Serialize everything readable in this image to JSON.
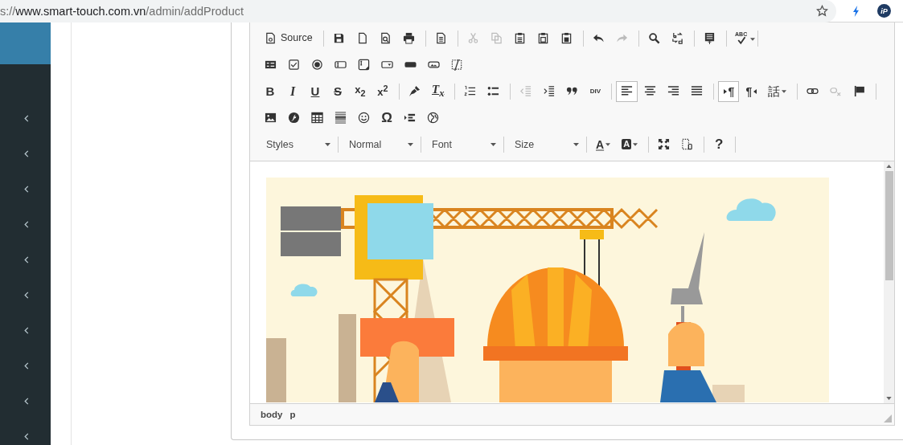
{
  "browser": {
    "url_prefix": "s://",
    "url_host": "www.smart-touch.com.vn",
    "url_path": "/admin/addProduct",
    "extension_badge": "iP"
  },
  "editor": {
    "toolbar": [
      [
        [
          {
            "kind": "source",
            "label": "Source",
            "disabled": false,
            "selected": false
          }
        ],
        [
          {
            "kind": "save",
            "disabled": false,
            "selected": false
          },
          {
            "kind": "newpage",
            "disabled": false,
            "selected": false
          },
          {
            "kind": "preview",
            "disabled": false,
            "selected": false
          },
          {
            "kind": "print",
            "disabled": false,
            "selected": false
          }
        ],
        [
          {
            "kind": "templates",
            "disabled": false,
            "selected": false
          }
        ],
        [
          {
            "kind": "cut",
            "disabled": true,
            "selected": false
          },
          {
            "kind": "copy",
            "disabled": true,
            "selected": false
          },
          {
            "kind": "paste",
            "disabled": false,
            "selected": false
          },
          {
            "kind": "paste-text",
            "disabled": false,
            "selected": false
          },
          {
            "kind": "paste-word",
            "disabled": false,
            "selected": false
          }
        ],
        [
          {
            "kind": "undo",
            "disabled": false,
            "selected": false
          },
          {
            "kind": "redo",
            "disabled": true,
            "selected": false
          }
        ],
        [
          {
            "kind": "find",
            "disabled": false,
            "selected": false
          },
          {
            "kind": "replace",
            "disabled": false,
            "selected": false
          }
        ],
        [
          {
            "kind": "selectall",
            "disabled": false,
            "selected": false
          }
        ],
        [
          {
            "kind": "spellcheck",
            "label": "ABC",
            "dropdown": true,
            "disabled": false,
            "selected": false
          }
        ]
      ],
      [
        [
          {
            "kind": "form",
            "disabled": false,
            "selected": false
          },
          {
            "kind": "checkbox",
            "disabled": false,
            "selected": false
          },
          {
            "kind": "radio",
            "disabled": false,
            "selected": false
          },
          {
            "kind": "textfield",
            "disabled": false,
            "selected": false
          },
          {
            "kind": "textarea",
            "disabled": false,
            "selected": false
          },
          {
            "kind": "select",
            "disabled": false,
            "selected": false
          },
          {
            "kind": "button",
            "disabled": false,
            "selected": false
          },
          {
            "kind": "imagebutton",
            "disabled": false,
            "selected": false
          },
          {
            "kind": "hiddenfield",
            "disabled": false,
            "selected": false
          }
        ]
      ],
      [
        [
          {
            "kind": "bold",
            "label": "B",
            "disabled": false,
            "selected": false
          },
          {
            "kind": "italic",
            "label": "I",
            "disabled": false,
            "selected": false
          },
          {
            "kind": "underline",
            "label": "U",
            "disabled": false,
            "selected": false
          },
          {
            "kind": "strike",
            "label": "S",
            "disabled": false,
            "selected": false
          },
          {
            "kind": "subscript",
            "label": "x$_{2}$",
            "disabled": false,
            "selected": false
          },
          {
            "kind": "superscript",
            "label": "x$^{2}$",
            "disabled": false,
            "selected": false
          }
        ],
        [
          {
            "kind": "copyformat",
            "disabled": false,
            "selected": false
          },
          {
            "kind": "removeformat",
            "label": "T$_{x}$",
            "disabled": false,
            "selected": false
          }
        ],
        [
          {
            "kind": "numbered",
            "disabled": false,
            "selected": false
          },
          {
            "kind": "bulleted",
            "disabled": false,
            "selected": false
          }
        ],
        [
          {
            "kind": "outdent",
            "disabled": true,
            "selected": false
          },
          {
            "kind": "indent",
            "disabled": false,
            "selected": false
          },
          {
            "kind": "blockquote",
            "disabled": false,
            "selected": false
          },
          {
            "kind": "creatediv",
            "label": "DIV",
            "disabled": false,
            "selected": false
          }
        ],
        [
          {
            "kind": "align-left",
            "disabled": false,
            "selected": true
          },
          {
            "kind": "align-center",
            "disabled": false,
            "selected": false
          },
          {
            "kind": "align-right",
            "disabled": false,
            "selected": false
          },
          {
            "kind": "justify",
            "disabled": false,
            "selected": false
          }
        ],
        [
          {
            "kind": "ltr",
            "label": "¶",
            "disabled": false,
            "selected": true
          },
          {
            "kind": "rtl",
            "label": "¶",
            "disabled": false,
            "selected": false
          },
          {
            "kind": "language",
            "label": "話",
            "dropdown": true,
            "disabled": false,
            "selected": false
          }
        ],
        [
          {
            "kind": "link",
            "disabled": false,
            "selected": false
          },
          {
            "kind": "unlink",
            "disabled": true,
            "selected": false
          },
          {
            "kind": "anchor",
            "disabled": false,
            "selected": false
          }
        ]
      ],
      [
        [
          {
            "kind": "image",
            "disabled": false,
            "selected": false
          },
          {
            "kind": "flash",
            "disabled": false,
            "selected": false
          },
          {
            "kind": "table",
            "disabled": false,
            "selected": false
          },
          {
            "kind": "hr",
            "disabled": false,
            "selected": false
          },
          {
            "kind": "smiley",
            "disabled": false,
            "selected": false
          },
          {
            "kind": "specialchar",
            "label": "Ω",
            "disabled": false,
            "selected": false
          },
          {
            "kind": "pagebreak",
            "disabled": false,
            "selected": false
          },
          {
            "kind": "iframe",
            "disabled": false,
            "selected": false
          }
        ]
      ],
      [
        [
          {
            "kind": "combo",
            "label": "Styles"
          }
        ],
        [
          {
            "kind": "combo",
            "label": "Normal"
          }
        ],
        [
          {
            "kind": "combo",
            "label": "Font"
          }
        ],
        [
          {
            "kind": "combo",
            "label": "Size"
          }
        ],
        [
          {
            "kind": "textcolor",
            "label": "A",
            "dropdown": true,
            "disabled": false,
            "selected": false
          },
          {
            "kind": "bgcolor",
            "label": "A",
            "dropdown": true,
            "disabled": false,
            "selected": false
          }
        ],
        [
          {
            "kind": "maximize",
            "disabled": false,
            "selected": false
          },
          {
            "kind": "showblocks",
            "disabled": false,
            "selected": false
          }
        ],
        [
          {
            "kind": "about",
            "label": "?",
            "disabled": false,
            "selected": false
          }
        ]
      ]
    ],
    "path": [
      "body",
      "p"
    ]
  }
}
